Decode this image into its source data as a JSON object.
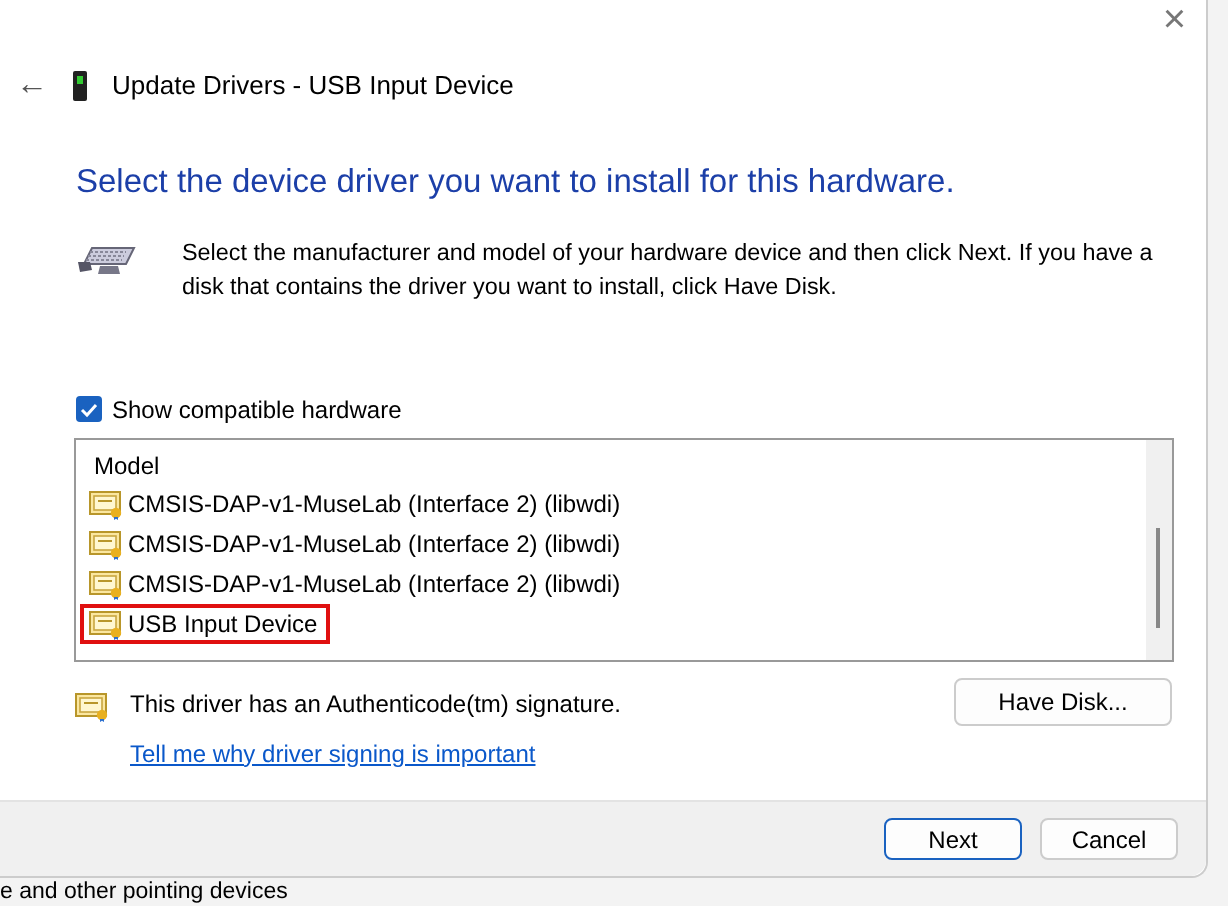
{
  "window": {
    "title": "Update Drivers - USB Input Device",
    "close": "×",
    "back": "←"
  },
  "heading": "Select the device driver you want to install for this hardware.",
  "description": "Select the manufacturer and model of your hardware device and then click Next. If you have a disk that contains the driver you want to install, click Have Disk.",
  "compatible": {
    "label": "Show compatible hardware",
    "checked": true
  },
  "model_list": {
    "header": "Model",
    "items": [
      {
        "label": "CMSIS-DAP-v1-MuseLab (Interface 2) (libwdi)",
        "marked": false
      },
      {
        "label": "CMSIS-DAP-v1-MuseLab (Interface 2) (libwdi)",
        "marked": false
      },
      {
        "label": "CMSIS-DAP-v1-MuseLab (Interface 2) (libwdi)",
        "marked": false
      },
      {
        "label": "USB Input Device",
        "marked": true
      }
    ]
  },
  "signature": {
    "text": "This driver has an Authenticode(tm) signature.",
    "link": "Tell me why driver signing is important"
  },
  "have_disk": "Have Disk...",
  "buttons": [
    {
      "label": "Next",
      "default": true
    },
    {
      "label": "Cancel",
      "default": false
    }
  ],
  "background_text": "e and other pointing devices"
}
